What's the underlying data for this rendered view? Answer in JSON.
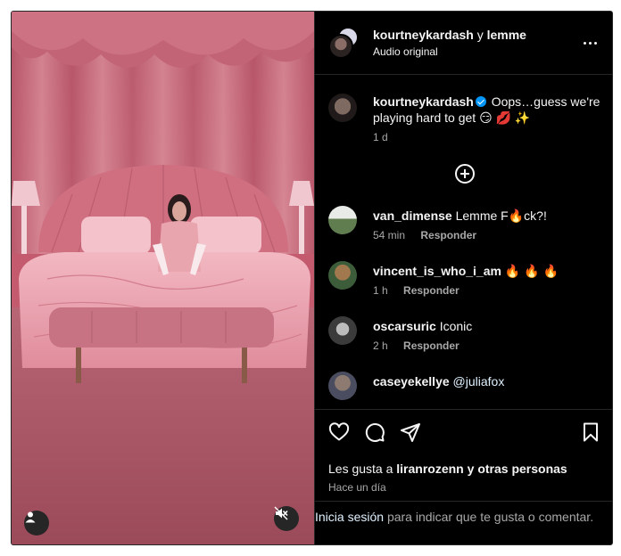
{
  "post": {
    "header": {
      "author": "kourtneykardash",
      "joiner": "y",
      "collaborator": "lemme",
      "audio": "Audio original"
    },
    "caption": {
      "username": "kourtneykardash",
      "text": "Oops…guess we're playing hard to get 😏 💋 ✨",
      "age": "1 d"
    },
    "comments": [
      {
        "username": "van_dimense",
        "text": "Lemme F🔥ck?!",
        "age": "54 min",
        "reply_label": "Responder"
      },
      {
        "username": "vincent_is_who_i_am",
        "text": "🔥 🔥 🔥",
        "age": "1 h",
        "reply_label": "Responder"
      },
      {
        "username": "oscarsuric",
        "text": "Iconic",
        "age": "2 h",
        "reply_label": "Responder"
      },
      {
        "username": "caseyekellye",
        "text": "@juliafox",
        "age": "",
        "reply_label": ""
      }
    ],
    "likes": {
      "prefix": "Les gusta a",
      "user": "liranrozenn",
      "suffix": "y otras personas"
    },
    "posted": "Hace un día",
    "login": {
      "link": "Inicia sesión",
      "text": "para indicar que te gusta o comentar."
    }
  },
  "icons": {
    "more": "more-options-icon",
    "load_more": "plus-circle-icon",
    "like": "heart-icon",
    "comment": "comment-icon",
    "share": "paper-plane-icon",
    "save": "bookmark-icon",
    "tagged": "user-icon",
    "mute": "speaker-muted-icon"
  },
  "colors": {
    "background": "#000000",
    "text": "#f5f5f5",
    "secondary": "#a8a8a8",
    "verified": "#0095f6",
    "link": "#e0f1ff"
  }
}
